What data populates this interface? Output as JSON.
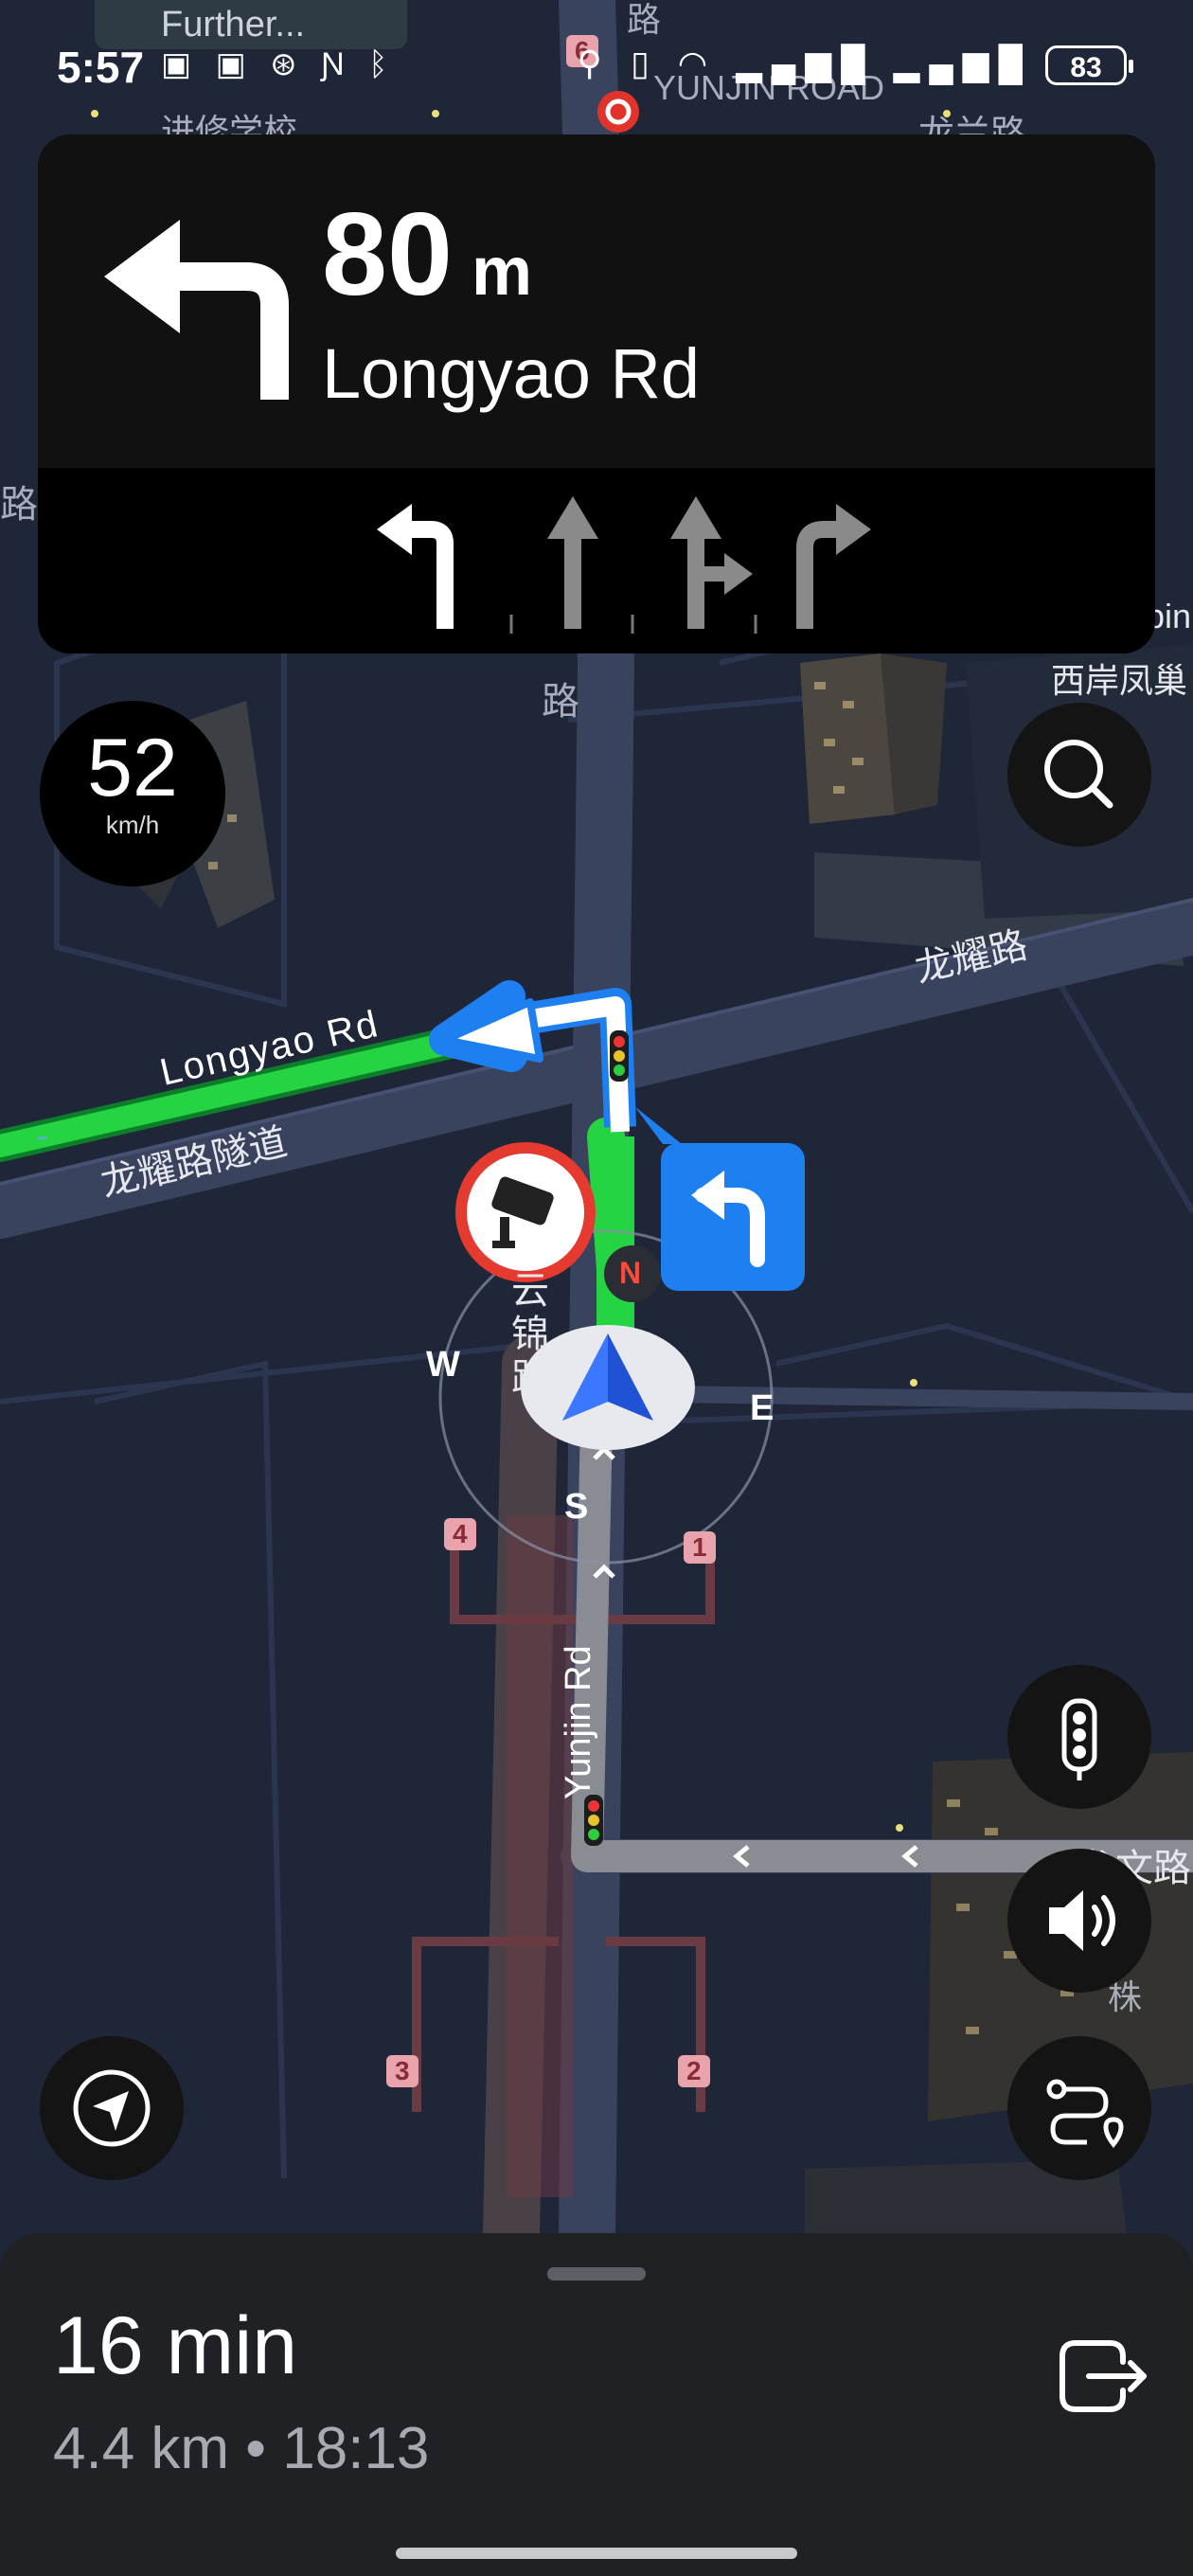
{
  "status_bar": {
    "time": "5:57",
    "battery": "83",
    "notification_text": "Further..."
  },
  "guidance": {
    "turn": "turn-left",
    "distance_value": "80",
    "distance_unit": "m",
    "street": "Longyao Rd",
    "lanes": [
      "left-turn",
      "straight",
      "straight-right",
      "right-turn"
    ]
  },
  "speed": {
    "value": "52",
    "unit": "km/h"
  },
  "map_labels": {
    "longyao_en": "Longyao Rd",
    "longyao_cn": "龙耀路",
    "longyao_tunnel_cn": "龙耀路隧道",
    "yunjin_en": "Yunjin Rd",
    "yunjin_road_top": "YUNJIN ROAD",
    "yunjin_cn_vertical": "云锦路",
    "yunjin_cn_right": "云锦路",
    "lu_top": "路",
    "lu_mid": "路",
    "lu_left": "路",
    "longwen_cn": "龙文路",
    "longlan_cn": "龙兰路",
    "xian_cn": "西岸凤巢",
    "jinxiu_cn": "进修学校",
    "yunjin_station_cn": "云锦路",
    "zhu_cn": "株",
    "pin_text": "pin",
    "compass_n": "N",
    "compass_s": "S",
    "compass_e": "E",
    "compass_w": "W",
    "exit_1": "1",
    "exit_2": "2",
    "exit_3": "3",
    "exit_4": "4",
    "exit_6": "6"
  },
  "trip": {
    "eta_duration": "16 min",
    "distance": "4.4 km",
    "separator": "•",
    "arrival_time": "18:13"
  },
  "icons": {
    "search": "search-icon",
    "traffic_light": "traffic-light-icon",
    "volume": "volume-icon",
    "route_overview": "route-overview-icon",
    "locate": "locate-icon",
    "exit": "exit-navigation-icon"
  },
  "colors": {
    "route_green": "#25d442",
    "maneuver_blue": "#1e7ff0",
    "map_bg": "#1f2638"
  }
}
